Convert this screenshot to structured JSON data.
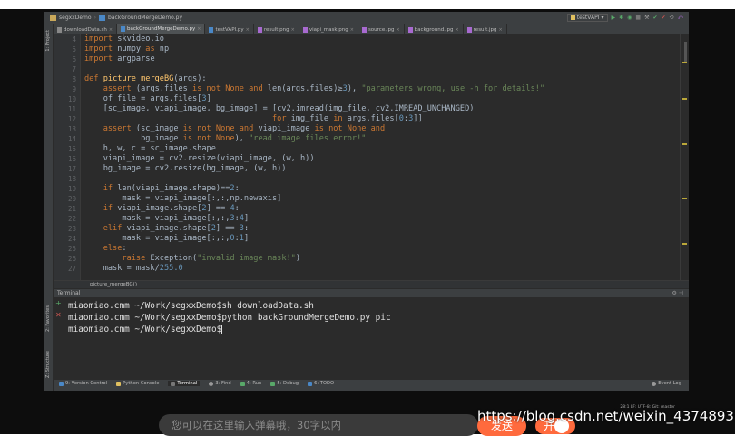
{
  "titlebar": {
    "project": "segxxDemo",
    "file": "backGroundMergeDemo.py",
    "run_config": "testVAPI"
  },
  "tool_strip": {
    "project_tab": "1: Project",
    "favorites_tab": "2: Favorites",
    "structure_tab": "Z: Structure"
  },
  "tabs": [
    {
      "label": "downloadData.sh"
    },
    {
      "label": "backGroundMergeDemo.py"
    },
    {
      "label": "testVAPI.py"
    },
    {
      "label": "result.png"
    },
    {
      "label": "viapi_mask.png"
    },
    {
      "label": "source.jpg"
    },
    {
      "label": "background.jpg"
    },
    {
      "label": "result.jpg"
    }
  ],
  "editor": {
    "line_numbers": [
      "4",
      "5",
      "6",
      "7",
      "8",
      "9",
      "10",
      "11",
      "12",
      "13",
      "14",
      "15",
      "16",
      "17",
      "18",
      "19",
      "20",
      "21",
      "22",
      "23",
      "24",
      "25",
      "26",
      "27"
    ],
    "breadcrumb": "picture_mergeBG()"
  },
  "terminal": {
    "title": "Terminal",
    "lines": [
      "miaomiao.cmm ~/Work/segxxDemo$sh downloadData.sh",
      "miaomiao.cmm ~/Work/segxxDemo$python backGroundMergeDemo.py pic",
      "miaomiao.cmm ~/Work/segxxDemo$"
    ]
  },
  "tooltabs": [
    {
      "label": "9: Version Control"
    },
    {
      "label": "Python Console"
    },
    {
      "label": "Terminal"
    },
    {
      "label": "3: Find"
    },
    {
      "label": "4: Run"
    },
    {
      "label": "5: Debug"
    },
    {
      "label": "6: TODO"
    }
  ],
  "event_log": "Event Log",
  "status": "28:1  LF:  UTF-8:  Git: master",
  "overlay": {
    "danmu_placeholder": "您可以在这里输入弹幕哦，30字以内",
    "send_label": "发送",
    "toggle_label": "开",
    "watermark": "https://blog.csdn.net/weixin_43748939"
  },
  "colors": {
    "keyword": "#cc7832",
    "string": "#6a8759",
    "number": "#6897bb",
    "accent": "#ff6a3d"
  }
}
